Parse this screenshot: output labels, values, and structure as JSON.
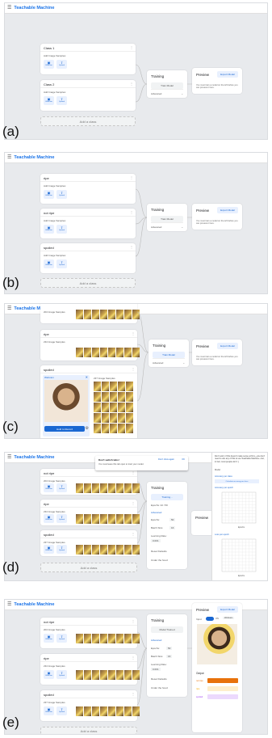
{
  "app": {
    "title": "Teachable Machine"
  },
  "labels": [
    "(a)",
    "(b)",
    "(c)",
    "(d)",
    "(e)"
  ],
  "a": {
    "classes": [
      {
        "name": "Class 1",
        "count": "Add Image Samples:"
      },
      {
        "name": "Class 2",
        "count": "Add Image Samples:"
      }
    ],
    "webcam": "Webcam",
    "upload": "Upload",
    "add_class": "Add a class",
    "training": {
      "title": "Training",
      "button": "Train Model",
      "advanced": "Advanced"
    },
    "preview": {
      "title": "Preview",
      "export": "Export Model",
      "message": "You must train a model on the left before you can preview it here."
    }
  },
  "b": {
    "classes": [
      {
        "name": "ripe",
        "count": "Add Image Samples:"
      },
      {
        "name": "not ripe",
        "count": "Add Image Samples:"
      },
      {
        "name": "spoiled",
        "count": "Add Image Samples:"
      }
    ],
    "webcam": "Webcam",
    "upload": "Upload",
    "add_class": "Add a class",
    "training": {
      "title": "Training",
      "button": "Train Model",
      "advanced": "Advanced"
    },
    "preview": {
      "title": "Preview",
      "export": "Export Model",
      "message": "You must train a model on the left before you can preview it here."
    }
  },
  "c": {
    "classes": [
      {
        "name": "not ripe",
        "count": "204 Image Samples"
      },
      {
        "name": "ripe",
        "count": "234 Image Samples"
      },
      {
        "name": "spoiled",
        "count": "237 Image Samples"
      }
    ],
    "webcam_panel": {
      "title": "Webcam",
      "hold": "Hold to Record"
    },
    "webcam": "Webcam",
    "upload": "Upload",
    "training": {
      "title": "Training",
      "button": "Train Model",
      "advanced": "Advanced"
    },
    "preview": {
      "title": "Preview",
      "export": "Export Model",
      "message": "You must train a model on the left before you can preview it here."
    }
  },
  "d": {
    "classes": [
      {
        "name": "not ripe",
        "count": "204 Image Samples"
      },
      {
        "name": "ripe",
        "count": "234 Image Samples"
      },
      {
        "name": "spoiled",
        "count": "237 Image Samples"
      }
    ],
    "webcam": "Webcam",
    "upload": "Upload",
    "add_class": "Add a class",
    "toast": {
      "title": "Don't switch tabs!",
      "text": "You must leave this tab open to train your model.",
      "dismiss": "Don't show again",
      "ok": "OK"
    },
    "training": {
      "title": "Training",
      "button": "Training...",
      "epochs": "Epochs: 42 / 50",
      "advanced": "Advanced",
      "epochs_label": "Epochs:",
      "epochs_val": "50",
      "batch_label": "Batch Size:",
      "batch_val": "16",
      "lr_label": "Learning Rate:",
      "lr_val": "0.001",
      "reset": "Reset Defaults",
      "under_hood": "Under the hood"
    },
    "preview": {
      "title": "Preview"
    },
    "side": {
      "intro": "Don't worry if this doesn't make sense at first—you don't need to use any of this to use Teachable Machine—but, in fact, most people don't :)",
      "model": "Model",
      "acc_class": "Accuracy per class",
      "calc": "Calculate accuracy per class",
      "acc_epoch": "Accuracy per epoch",
      "loss_epoch": "Loss per epoch",
      "xlabel": "Epochs",
      "ylabel_acc": "Accuracy",
      "ylabel_loss": "Loss",
      "legend1": "acc",
      "legend2": "test acc",
      "legend3": "loss",
      "legend4": "test loss"
    }
  },
  "e": {
    "classes": [
      {
        "name": "not ripe",
        "count": "204 Image Samples"
      },
      {
        "name": "ripe",
        "count": "234 Image Samples"
      },
      {
        "name": "spoiled",
        "count": "237 Image Samples"
      }
    ],
    "webcam": "Webcam",
    "upload": "Upload",
    "add_class": "Add a class",
    "training": {
      "title": "Training",
      "button": "Model Trained",
      "advanced": "Advanced",
      "epochs_label": "Epochs:",
      "epochs_val": "50",
      "batch_label": "Batch Size:",
      "batch_val": "16",
      "lr_label": "Learning Rate:",
      "lr_val": "0.001",
      "reset": "Reset Defaults",
      "under_hood": "Under the hood"
    },
    "preview": {
      "title": "Preview",
      "export": "Export Model",
      "input": "Input",
      "on": "ON",
      "source": "Webcam",
      "output": "Output",
      "outputs": [
        {
          "name": "not ripe",
          "pct": 100,
          "color": "#e8710a"
        },
        {
          "name": "ripe",
          "pct": 0,
          "color": "#f9ab00"
        },
        {
          "name": "spoiled",
          "pct": 0,
          "color": "#a142f4"
        }
      ]
    }
  },
  "colors": {
    "accent": "#1a73e8",
    "chip": "#e8f0fe",
    "panel": "#e8eaed"
  }
}
